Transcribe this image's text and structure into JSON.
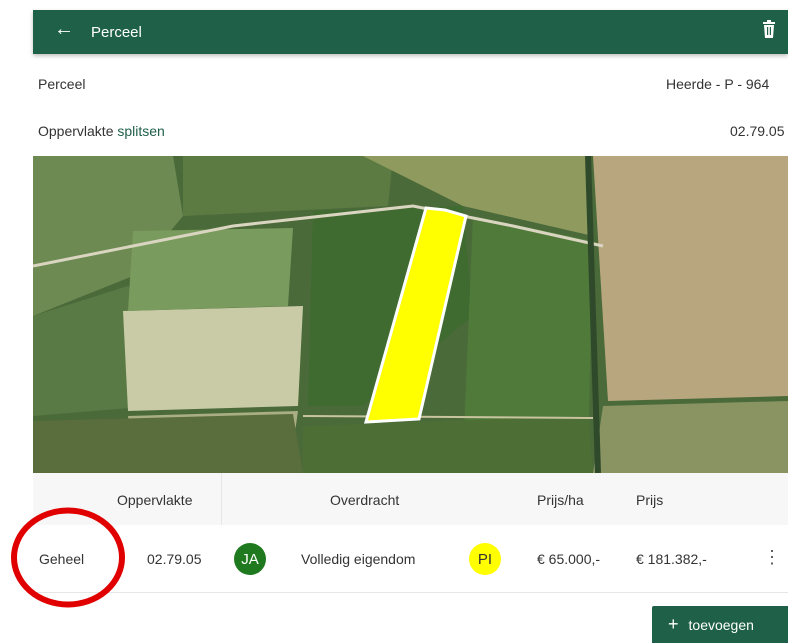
{
  "appbar": {
    "title": "Perceel",
    "back_icon": "arrow-left-icon",
    "delete_icon": "trash-icon"
  },
  "perceel": {
    "label": "Perceel",
    "value": "Heerde - P - 964"
  },
  "oppervlakte": {
    "label": "Oppervlakte",
    "split_link": "splitsen",
    "value": "02.79.05"
  },
  "map": {
    "parcel_color": "#ffff00"
  },
  "table": {
    "headers": {
      "oppervlakte": "Oppervlakte",
      "overdracht": "Overdracht",
      "prijs_ha": "Prijs/ha",
      "prijs": "Prijs"
    },
    "rows": [
      {
        "naam": "Geheel",
        "oppervlakte": "02.79.05",
        "overdracht_badge": "JA",
        "overdracht": "Volledig eigendom",
        "prijs_badge": "PI",
        "prijs_ha": "€ 65.000,-",
        "prijs": "€ 181.382,-"
      }
    ]
  },
  "add_button": {
    "label": "toevoegen"
  },
  "colors": {
    "primary": "#1f6049",
    "badge_green": "#1f7a1f",
    "badge_yellow": "#ffff00",
    "annotation": "#e00000"
  }
}
